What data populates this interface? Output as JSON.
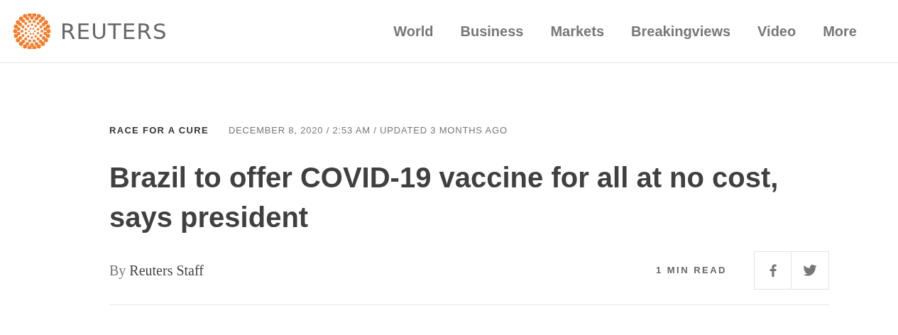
{
  "header": {
    "logo_text": "REUTERS",
    "nav": [
      {
        "label": "World"
      },
      {
        "label": "Business"
      },
      {
        "label": "Markets"
      },
      {
        "label": "Breakingviews"
      },
      {
        "label": "Video"
      },
      {
        "label": "More"
      }
    ]
  },
  "article": {
    "section": "RACE FOR A CURE",
    "dateline": "DECEMBER 8, 2020 / 2:53 AM / UPDATED 3 MONTHS AGO",
    "headline": "Brazil to offer COVID-19 vaccine for all at no cost, says president",
    "byline_prefix": "By",
    "author": "Reuters Staff",
    "read_time": "1 MIN READ",
    "share": [
      {
        "kind": "facebook"
      },
      {
        "kind": "twitter"
      }
    ]
  }
}
